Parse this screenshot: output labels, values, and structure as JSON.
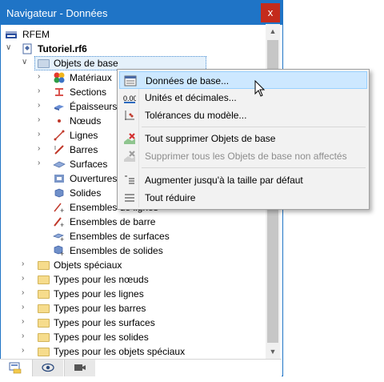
{
  "window": {
    "title": "Navigateur - Données",
    "close_label": "x"
  },
  "tree": {
    "root": "RFEM",
    "file": "Tutoriel.rf6",
    "group": "Objets de base",
    "items": [
      "Matériaux",
      "Sections",
      "Épaisseurs",
      "Nœuds",
      "Lignes",
      "Barres",
      "Surfaces",
      "Ouvertures",
      "Solides",
      "Ensembles de lignes",
      "Ensembles de barre",
      "Ensembles de surfaces",
      "Ensembles de solides"
    ],
    "folders": [
      "Objets spéciaux",
      "Types pour les nœuds",
      "Types pour les lignes",
      "Types pour les barres",
      "Types pour les surfaces",
      "Types pour les solides",
      "Types pour les objets spéciaux"
    ]
  },
  "context_menu": {
    "items": [
      {
        "label": "Données de base...",
        "icon": "basic-data-icon",
        "state": "highlighted"
      },
      {
        "label": "Unités et décimales...",
        "icon": "units-decimals-icon",
        "state": "normal"
      },
      {
        "label": "Tolérances du modèle...",
        "icon": "tolerances-icon",
        "state": "normal"
      },
      {
        "label": "Tout supprimer Objets de base",
        "icon": "delete-all-icon",
        "state": "normal"
      },
      {
        "label": "Supprimer tous les Objets de base non affectés",
        "icon": "delete-unassigned-icon",
        "state": "disabled"
      },
      {
        "label": "Augmenter jusqu'à la taille par défaut",
        "icon": "expand-icon",
        "state": "normal"
      },
      {
        "label": "Tout réduire",
        "icon": "collapse-icon",
        "state": "normal"
      }
    ]
  },
  "bottom_tabs": [
    "data-tab-icon",
    "view-tab-icon",
    "camera-tab-icon"
  ]
}
